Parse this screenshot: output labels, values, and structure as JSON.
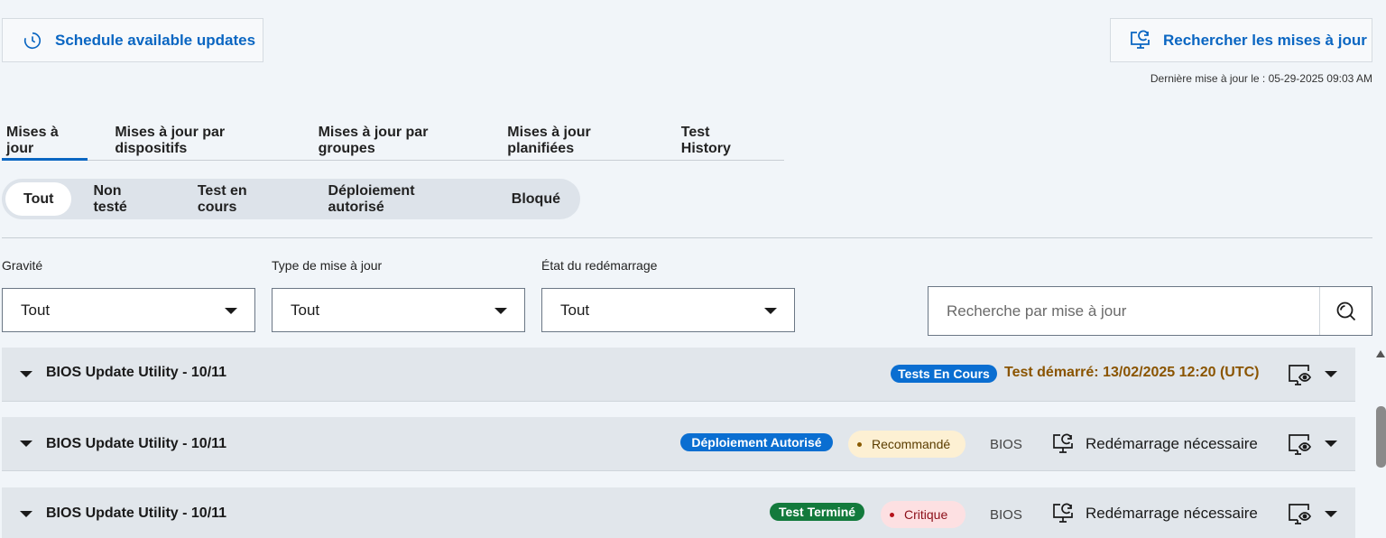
{
  "header": {
    "schedule_label": "Schedule available updates",
    "check_label": "Rechercher les mises à jour",
    "last_update": "Dernière mise à jour le : 05-29-2025 09:03 AM"
  },
  "tabs": [
    {
      "label": "Mises à jour",
      "active": true
    },
    {
      "label": "Mises à jour par dispositifs"
    },
    {
      "label": "Mises à jour par groupes"
    },
    {
      "label": "Mises à jour planifiées"
    },
    {
      "label": "Test History"
    }
  ],
  "segments": [
    {
      "label": "Tout",
      "active": true
    },
    {
      "label": "Non testé"
    },
    {
      "label": "Test en cours"
    },
    {
      "label": "Déploiement autorisé"
    },
    {
      "label": "Bloqué"
    }
  ],
  "filters": {
    "severity": {
      "label": "Gravité",
      "value": "Tout"
    },
    "type": {
      "label": "Type de mise à jour",
      "value": "Tout"
    },
    "reboot": {
      "label": "État du redémarrage",
      "value": "Tout"
    },
    "search_placeholder": "Recherche par mise à jour"
  },
  "rows": [
    {
      "title": "BIOS Update Utility - 10/11",
      "status": "Tests En Cours",
      "status_color": "#0a6ed1",
      "started": "Test démarré: 13/02/2025 12:20 (UTC)"
    },
    {
      "title": "BIOS Update Utility - 10/11",
      "status": "Déploiement Autorisé",
      "status_color": "#0a6ed1",
      "severity": "Recommandé",
      "type": "BIOS",
      "reboot": "Redémarrage nécessaire"
    },
    {
      "title": "BIOS Update Utility - 10/11",
      "status": "Test Terminé",
      "status_color": "#137a3c",
      "severity": "Critique",
      "type": "BIOS",
      "reboot": "Redémarrage nécessaire"
    }
  ],
  "icons": {
    "schedule": "clock-icon",
    "check": "monitor-refresh-icon",
    "search": "search-icon",
    "view": "monitor-eye-icon",
    "reboot": "monitor-refresh-icon"
  }
}
